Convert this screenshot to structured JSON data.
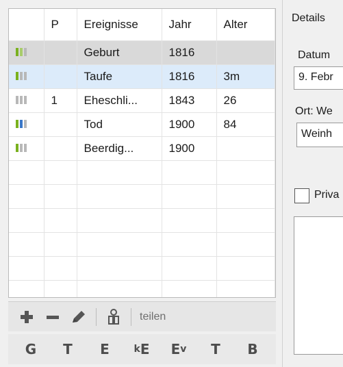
{
  "table": {
    "headers": {
      "p": "P",
      "name": "Ereignisse",
      "year": "Jahr",
      "age": "Alter"
    },
    "rows": [
      {
        "p": "",
        "name": "Geburt",
        "year": "1816",
        "age": ""
      },
      {
        "p": "",
        "name": "Taufe",
        "year": "1816",
        "age": "3m"
      },
      {
        "p": "1",
        "name": "Eheschli...",
        "year": "1843",
        "age": "26"
      },
      {
        "p": "",
        "name": "Tod",
        "year": "1900",
        "age": "84"
      },
      {
        "p": "",
        "name": "Beerdig...",
        "year": "1900",
        "age": ""
      }
    ]
  },
  "toolbar": {
    "add_icon": "plus-icon",
    "remove_icon": "minus-icon",
    "edit_icon": "pencil-icon",
    "witness_icon": "person-icon",
    "share_label": "teilen"
  },
  "type_buttons": {
    "g": "G",
    "t": "T",
    "e": "E",
    "ke_k": "k",
    "ke_e": "E",
    "ev_e": "E",
    "ev_v": "v",
    "t2": "T",
    "b": "B"
  },
  "details": {
    "title": "Details",
    "datum_label": "Datum",
    "datum_value": "9. Febr",
    "ort_label": "Ort: We",
    "ort_value": "Weinh",
    "private_label": "Priva"
  },
  "colors": {
    "selected_gray": "#d9d9d9",
    "selected_blue": "#dcebfa",
    "indicator_green": "#7ab11f",
    "indicator_blue": "#3a77c8"
  }
}
